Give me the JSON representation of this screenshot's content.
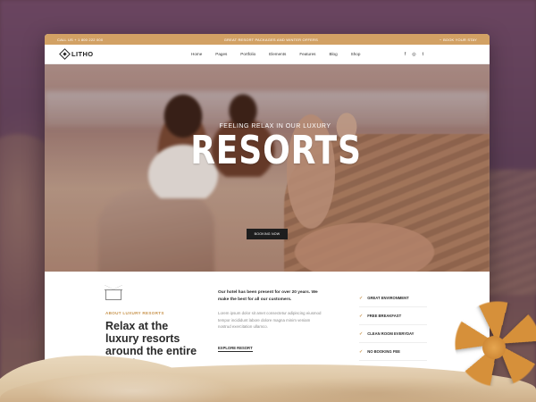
{
  "topbar": {
    "phone": "CALL US + 1 800 222 000",
    "promo": "GREAT RESORT PACKAGES AND WINTER OFFERS",
    "cta": "BOOK YOUR STAY"
  },
  "nav": {
    "logo": "LITHO",
    "items": [
      "Home",
      "Pages",
      "Portfolio",
      "Elements",
      "Features",
      "Blog",
      "Shop"
    ],
    "social": [
      "f",
      "◎",
      "t"
    ]
  },
  "hero": {
    "subtitle": "FEELING RELAX IN OUR LUXURY",
    "title": "RESORTS",
    "button": "BOOKING NOW",
    "active_slide": 0,
    "slide_count": 3
  },
  "about": {
    "eyebrow": "ABOUT LUXURY RESORTS",
    "title": "Relax at the luxury resorts around the entire world",
    "lead": "Our hotel has been present for over 20 years. We make the best for all our customers.",
    "body": "Lorem ipsum dolor sit amet consectetur adipiscing eiusmod tempor incididunt labore dolore magna minim veniam nostrud exercitation ullamco.",
    "link": "EXPLORE RESORT",
    "features": [
      "GREAT ENVIRONMENT",
      "FREE BREAKFAST",
      "CLEAN ROOM EVERYDAY",
      "NO BOOKING FEE"
    ]
  },
  "colors": {
    "accent": "#d2a164",
    "dark": "#1e1e1e"
  }
}
